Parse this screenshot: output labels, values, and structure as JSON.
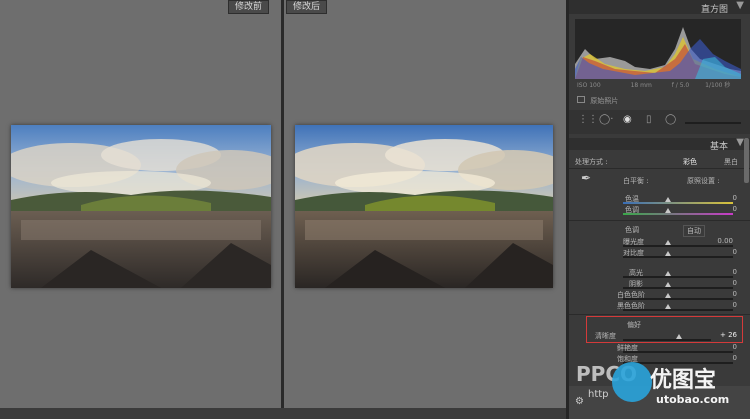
{
  "preview": {
    "before_label": "修改前",
    "after_label": "修改后"
  },
  "panel": {
    "histogram_title": "直方图",
    "exif": {
      "iso": "ISO 100",
      "focal": "18 mm",
      "aperture": "f / 5.0",
      "shutter": "1/100 秒"
    },
    "original_photo_label": "原始照片",
    "basic_title": "基本",
    "treatment_label": "处理方式 :",
    "color_option": "彩色",
    "bw_option": "黑白",
    "wb_label": "白平衡 :",
    "wb_value": "原照设置 :",
    "temp_label": "色温",
    "temp_value": "0",
    "tint_label": "色调",
    "tint_value": "0",
    "tone_label": "色调",
    "auto_label": "自动",
    "exposure_label": "曝光度",
    "exposure_value": "0.00",
    "contrast_label": "对比度",
    "contrast_value": "0",
    "highlights_label": "高光",
    "highlights_value": "0",
    "shadows_label": "阴影",
    "shadows_value": "0",
    "whites_label": "白色色阶",
    "whites_value": "0",
    "blacks_label": "黑色色阶",
    "blacks_value": "0",
    "presence_label": "偏好",
    "clarity_label": "清晰度",
    "clarity_value": "+ 26",
    "vibrance_label": "鲜艳度",
    "vibrance_value": "0",
    "saturation_label": "饱和度",
    "saturation_value": "0"
  },
  "watermark": {
    "left_text": "PPCO",
    "url_text": "http",
    "brand_text": "优图宝",
    "brand_url": "utobao.com"
  },
  "colors": {
    "highlight_box": "#d43a3a",
    "panel_bg": "#3a3a3a"
  }
}
